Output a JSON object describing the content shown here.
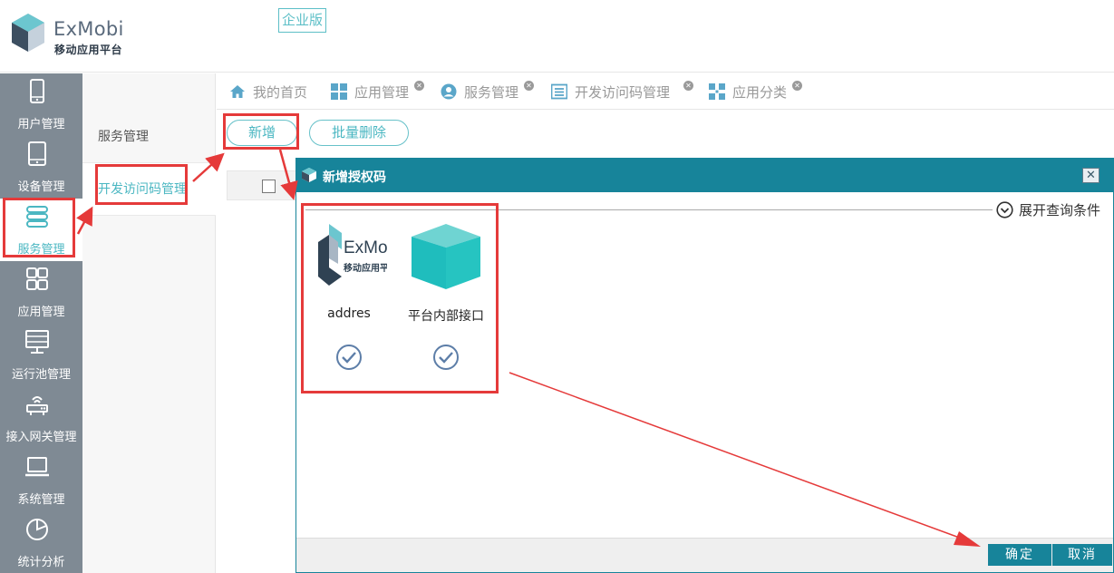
{
  "header": {
    "logo_name": "ExMobi",
    "logo_sub": "移动应用平台",
    "edition": "企业版"
  },
  "sidebar": {
    "items": [
      {
        "label": "用户管理",
        "icon": "phone-icon"
      },
      {
        "label": "设备管理",
        "icon": "tablet-icon"
      },
      {
        "label": "服务管理",
        "icon": "server-icon",
        "active": true
      },
      {
        "label": "应用管理",
        "icon": "grid-apps-icon"
      },
      {
        "label": "运行池管理",
        "icon": "server-rack-icon"
      },
      {
        "label": "接入网关管理",
        "icon": "router-icon"
      },
      {
        "label": "系统管理",
        "icon": "laptop-icon"
      },
      {
        "label": "统计分析",
        "icon": "pie-chart-icon"
      }
    ]
  },
  "submenu": {
    "items": [
      {
        "label": "服务管理"
      },
      {
        "label": "开发访问码管理",
        "active": true
      }
    ]
  },
  "tabs": [
    {
      "label": "我的首页",
      "icon": "home-icon",
      "closable": false
    },
    {
      "label": "应用管理",
      "icon": "grid-icon",
      "closable": true
    },
    {
      "label": "服务管理",
      "icon": "user-circle-icon",
      "closable": true
    },
    {
      "label": "开发访问码管理",
      "icon": "list-icon",
      "closable": true
    },
    {
      "label": "应用分类",
      "icon": "category-icon",
      "closable": true
    }
  ],
  "toolbar": {
    "add_label": "新增",
    "batch_delete_label": "批量删除"
  },
  "dialog": {
    "title": "新增授权码",
    "close_glyph": "✕",
    "query_toggle_label": "展开查询条件",
    "cards": [
      {
        "name": "addres",
        "logo_name": "ExMobi",
        "logo_sub": "移动应用平台",
        "icon": "exmobi-logo-icon"
      },
      {
        "name": "平台内部接口",
        "icon": "cube-icon"
      }
    ],
    "confirm_label": "确定",
    "cancel_label": "取消"
  },
  "colors": {
    "accent": "#4bb7c2",
    "sidebar_bg": "#7f8a94",
    "dialog_header": "#17849a",
    "annotation": "#e53a3a"
  }
}
